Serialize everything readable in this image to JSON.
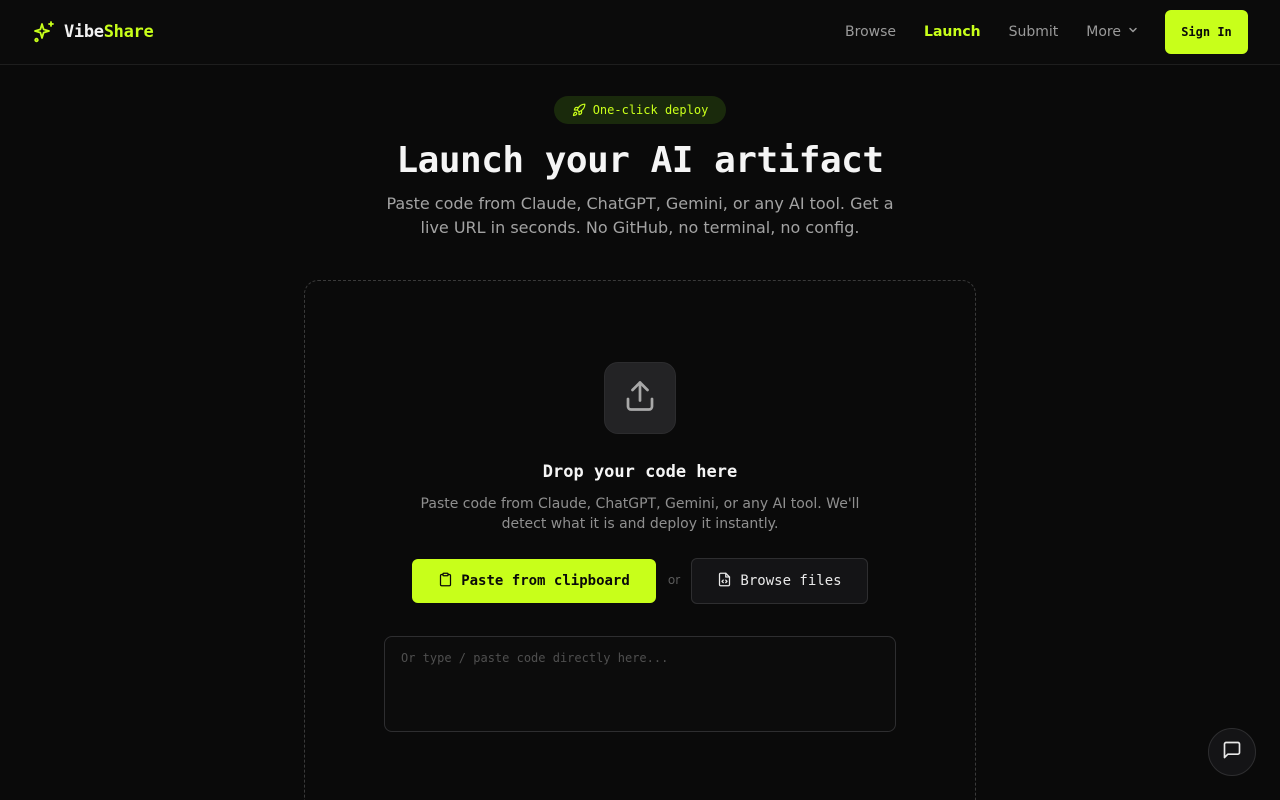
{
  "colors": {
    "accent": "#c8ff1a",
    "background": "#0a0a0a"
  },
  "header": {
    "logo_part1": "Vibe",
    "logo_part2": "Share",
    "logo_icon": "sparkles-icon",
    "nav": {
      "browse": "Browse",
      "launch": "Launch",
      "submit": "Submit",
      "more": "More"
    },
    "active_nav": "Launch",
    "signin_label": "Sign In"
  },
  "hero": {
    "badge_icon": "rocket-icon",
    "badge_label": "One-click deploy",
    "title": "Launch your AI artifact",
    "subtitle": "Paste code from Claude, ChatGPT, Gemini, or any AI tool. Get a live URL in seconds. No GitHub, no terminal, no config."
  },
  "dropzone": {
    "icon": "upload-icon",
    "title": "Drop your code here",
    "description": "Paste code from Claude, ChatGPT, Gemini, or any AI tool. We'll detect what it is and deploy it instantly.",
    "paste_button": "Paste from clipboard",
    "or_label": "or",
    "browse_button": "Browse files",
    "code_placeholder": "Or type / paste code directly here...",
    "code_value": ""
  },
  "chat": {
    "icon": "chat-bubble-icon"
  }
}
